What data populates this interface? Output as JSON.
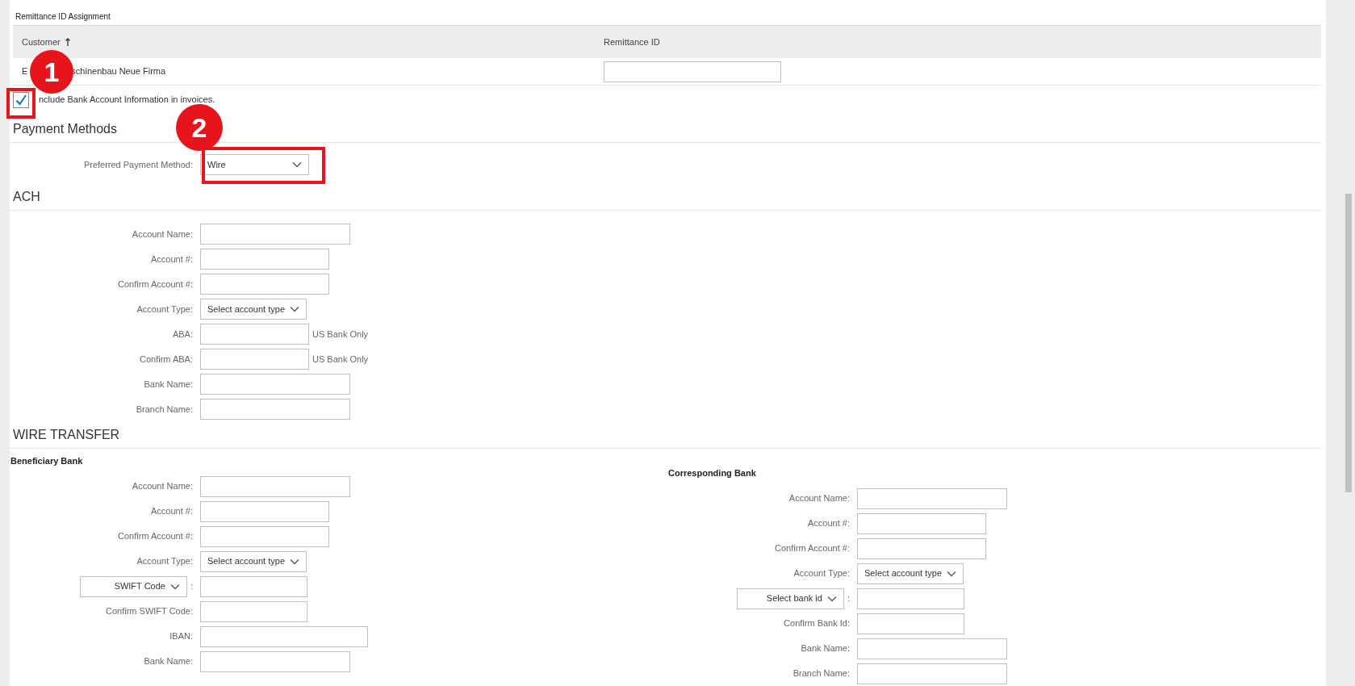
{
  "remittance": {
    "title": "Remittance ID Assignment",
    "columns": [
      {
        "label": "Customer",
        "sorted": true
      },
      {
        "label": "Remittance ID",
        "sorted": false
      }
    ],
    "rows": [
      {
        "customer_parts": [
          "E",
          "schinenbau Neue Firma"
        ]
      }
    ]
  },
  "include_bank_info": {
    "label": "nclude Bank Account Information in invoices.",
    "checked": true
  },
  "payment_methods": {
    "heading": "Payment Methods",
    "preferred": {
      "label": "Preferred Payment Method:",
      "value": "Wire"
    }
  },
  "ach": {
    "heading": "ACH",
    "fields": [
      {
        "kind": "wide",
        "label": "Account Name:"
      },
      {
        "kind": "medium",
        "label": "Account #:"
      },
      {
        "kind": "medium",
        "label": "Confirm Account #:"
      },
      {
        "kind": "select",
        "label": "Account Type:",
        "value": "Select account type"
      },
      {
        "kind": "narrow",
        "label": "ABA:",
        "note": "US Bank Only"
      },
      {
        "kind": "narrow",
        "label": "Confirm ABA:",
        "note": "US Bank Only"
      },
      {
        "kind": "wide",
        "label": "Bank Name:"
      },
      {
        "kind": "wide",
        "label": "Branch Name:"
      }
    ]
  },
  "wire_transfer": {
    "heading": "WIRE TRANSFER",
    "beneficiary": {
      "heading": "Beneficiary Bank",
      "fields": [
        {
          "kind": "wide",
          "label": "Account Name:"
        },
        {
          "kind": "medium",
          "label": "Account #:"
        },
        {
          "kind": "medium",
          "label": "Confirm Account #:"
        },
        {
          "kind": "select",
          "label": "Account Type:",
          "value": "Select account type"
        },
        {
          "kind": "select-label",
          "value": "SWIFT Code",
          "suffix": ":"
        },
        {
          "kind": "short",
          "label": "Confirm SWIFT Code:"
        },
        {
          "kind": "iban",
          "label": "IBAN:"
        },
        {
          "kind": "wide",
          "label": "Bank Name:"
        }
      ]
    },
    "corresponding": {
      "heading": "Corresponding Bank",
      "fields": [
        {
          "kind": "wide",
          "label": "Account Name:"
        },
        {
          "kind": "medium",
          "label": "Account #:"
        },
        {
          "kind": "medium",
          "label": "Confirm Account #:"
        },
        {
          "kind": "select",
          "label": "Account Type:",
          "value": "Select account type"
        },
        {
          "kind": "select-label",
          "value": "Select bank id",
          "suffix": ":"
        },
        {
          "kind": "short",
          "label": "Confirm Bank Id:"
        },
        {
          "kind": "wide",
          "label": "Bank Name:"
        },
        {
          "kind": "wide",
          "label": "Branch Name:"
        }
      ]
    }
  },
  "annotations": [
    {
      "number": "1"
    },
    {
      "number": "2"
    }
  ]
}
